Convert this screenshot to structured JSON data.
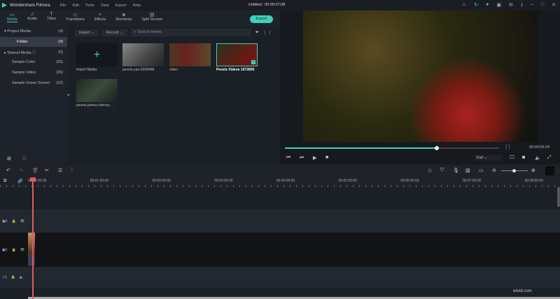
{
  "app": {
    "name": "Wondershare Filmora",
    "title": "Untitled : 00:00:07:08",
    "menu": [
      "File",
      "Edit",
      "Tools",
      "View",
      "Export",
      "Help"
    ]
  },
  "toolbar": {
    "tabs": [
      {
        "label": "Media",
        "icon": "folder-icon",
        "active": true
      },
      {
        "label": "Audio",
        "icon": "music-icon"
      },
      {
        "label": "Titles",
        "icon": "text-icon"
      },
      {
        "label": "Transitions",
        "icon": "transitions-icon"
      },
      {
        "label": "Effects",
        "icon": "effects-icon"
      },
      {
        "label": "Elements",
        "icon": "elements-icon"
      },
      {
        "label": "Split Screen",
        "icon": "split-screen-icon"
      }
    ],
    "export": "Export"
  },
  "sidebar": {
    "items": [
      {
        "label": "Project Media",
        "count": "(4)"
      },
      {
        "label": "Folder",
        "count": "(4)"
      },
      {
        "label": "Shared Media",
        "count": "(0)"
      },
      {
        "label": "Sample Color",
        "count": "(25)"
      },
      {
        "label": "Sample Video",
        "count": "(20)"
      },
      {
        "label": "Sample Green Screen",
        "count": "(10)"
      }
    ]
  },
  "media": {
    "import": "Import",
    "record": "Record",
    "search_placeholder": "Search media",
    "items": [
      "Import Media",
      "pexels-yan-6299968",
      "video",
      "Pexels Videos 1672805",
      "pexels-james-cheney-..."
    ]
  },
  "preview": {
    "time": "00:00:05:24",
    "quality": "Full",
    "progress": 0.71
  },
  "timeline": {
    "ticks": [
      "00:00:00:00",
      "00:01:00:00",
      "00:02:00:00",
      "00:03:00:00",
      "00:04:00:00",
      "00:05:00:00",
      "00:06:00:00",
      "00:07:00:00",
      "00:08:00:00"
    ],
    "tracks": [
      "2",
      "1",
      "1"
    ]
  },
  "watermark": "wtvid.com",
  "colors": {
    "accent": "#3fd1b8",
    "playhead": "#e05a5a"
  }
}
